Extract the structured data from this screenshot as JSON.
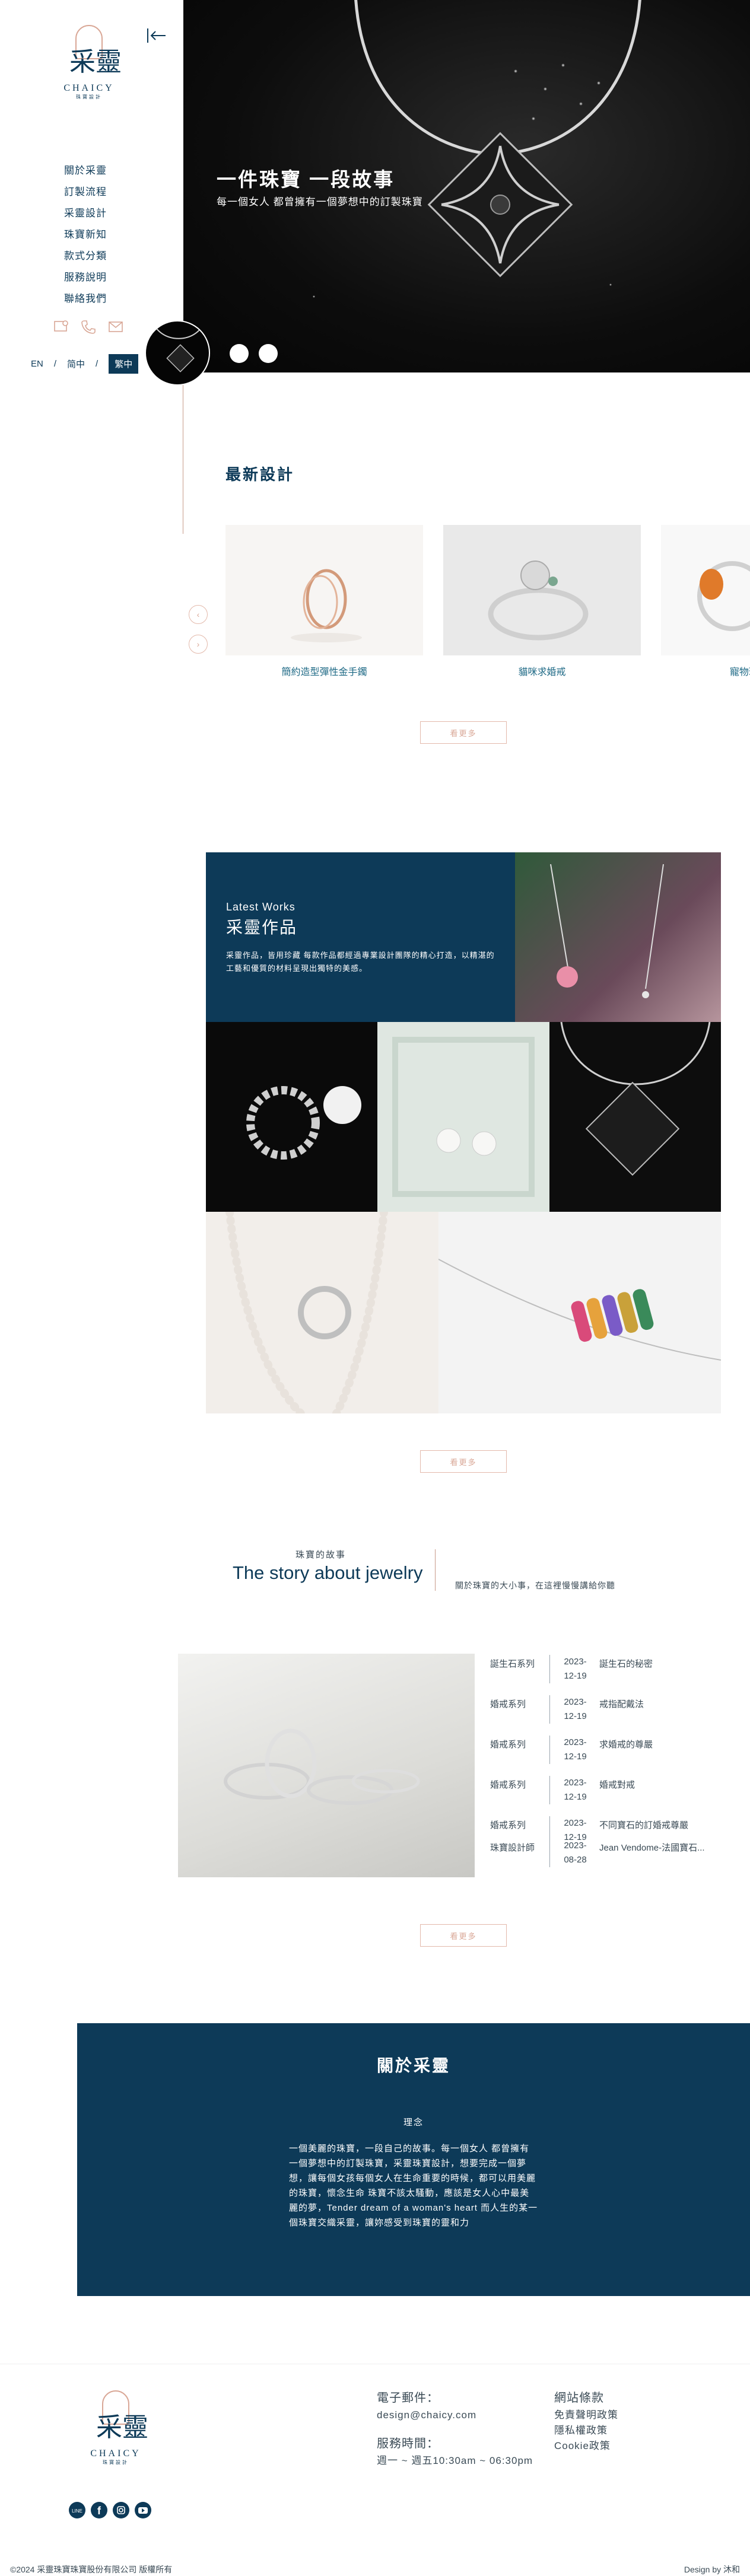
{
  "brand": {
    "name_zh": "采靈",
    "name_en": "CHAICY",
    "tagline": "珠寶設計"
  },
  "nav": {
    "items": [
      "關於采靈",
      "訂製流程",
      "采靈設計",
      "珠寶新知",
      "款式分類",
      "服務說明",
      "聯絡我們"
    ]
  },
  "lang": {
    "options": [
      "EN",
      "简中",
      "繁中"
    ],
    "active": "繁中"
  },
  "hero": {
    "title": "一件珠寶 一段故事",
    "subtitle": "每一個女人 都曾擁有一個夢想中的訂製珠寶",
    "slide_count": 3
  },
  "latest": {
    "title": "最新設計",
    "items": [
      {
        "label": "簡約造型彈性金手鐲"
      },
      {
        "label": "貓咪求婚戒"
      },
      {
        "label": "寵物珠寶-貓咪"
      }
    ],
    "more": "看更多"
  },
  "works": {
    "title_en": "Latest Works",
    "title_zh": "采靈作品",
    "description": "采靈作品，皆用珍藏 每款作品都經過專業設計團隊的精心打造，以精湛的工藝和優質的材料呈現出獨特的美感。",
    "more": "看更多"
  },
  "story": {
    "title_zh": "珠寶的故事",
    "title_en": "The story about jewelry",
    "description": "關於珠寶的大小事，在這裡慢慢講給你聽",
    "rows": [
      {
        "cat": "誕生石系列",
        "date": "2023-12-19",
        "title": "誕生石的秘密"
      },
      {
        "cat": "婚戒系列",
        "date": "2023-12-19",
        "title": "戒指配戴法"
      },
      {
        "cat": "婚戒系列",
        "date": "2023-12-19",
        "title": "求婚戒的尊嚴"
      },
      {
        "cat": "婚戒系列",
        "date": "2023-12-19",
        "title": "婚戒對戒"
      },
      {
        "cat": "婚戒系列",
        "date": "2023-12-19",
        "title": "不同寶石的訂婚戒尊嚴"
      },
      {
        "cat": "珠寶設計師",
        "date": "2023-08-28",
        "title": "Jean Vendome-法國寶石..."
      }
    ],
    "more": "看更多"
  },
  "about": {
    "title": "關於采靈",
    "subtitle": "理念",
    "text": "一個美麗的珠寶，一段自己的故事。每一個女人 都曾擁有一個夢想中的訂製珠寶，采靈珠寶設計，想要完成一個夢想，讓每個女孩每個女人在生命重要的時候，都可以用美麗的珠寶，懷念生命 珠寶不該太騷動，應該是女人心中最美麗的夢，Tender dream of a woman's heart 而人生的某一個珠寶交織采靈，讓妳感受到珠寶的靈和力"
  },
  "footer": {
    "email_label": "電子郵件：",
    "email": "design@chaicy.com",
    "hours_label": "服務時間：",
    "hours": "週一 ~ 週五10:30am ~ 06:30pm",
    "terms_label": "網站條款",
    "terms": [
      "免責聲明政策",
      "隱私權政策",
      "Cookie政策"
    ],
    "social": [
      "line-icon",
      "facebook-icon",
      "instagram-icon",
      "youtube-icon"
    ],
    "copyright": "©2024 采靈珠寶珠寶股份有限公司 版權所有",
    "credit": "Design by 沐和"
  },
  "colors": {
    "primary": "#0d3a58",
    "accent": "#d9a796",
    "link": "#1f6a86"
  }
}
